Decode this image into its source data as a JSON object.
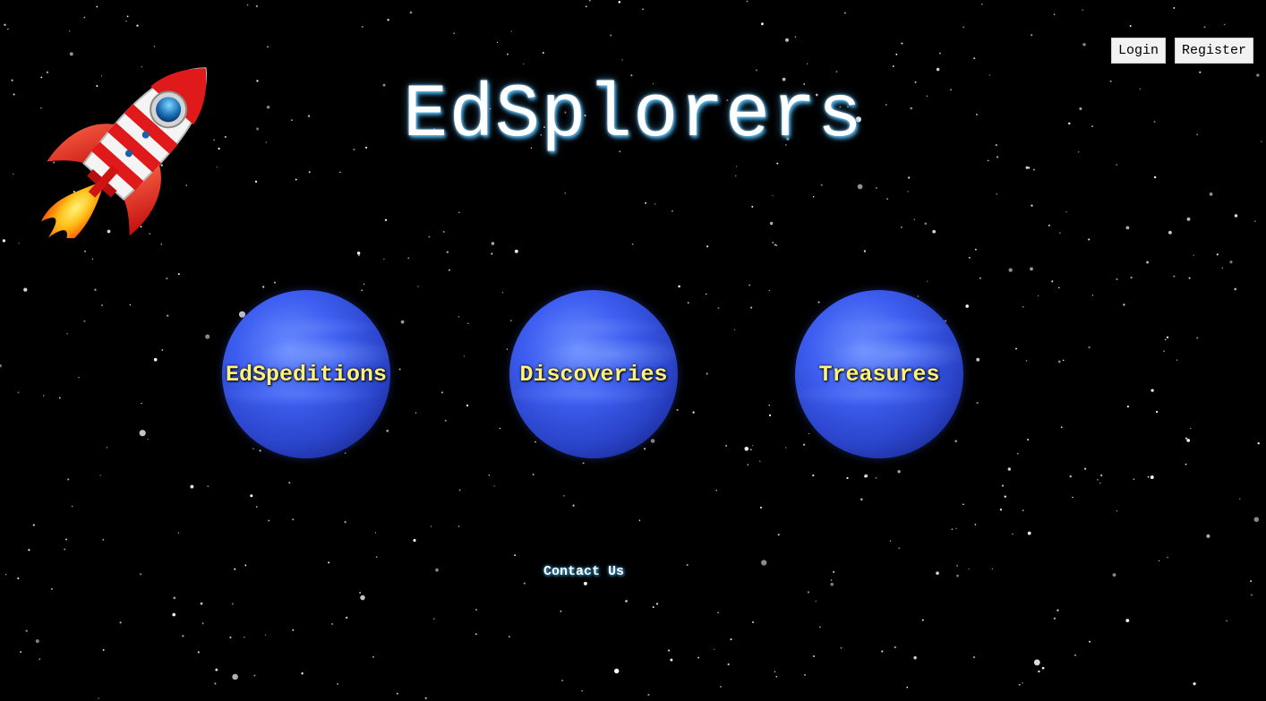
{
  "site": {
    "title": "EdSplorers"
  },
  "auth": {
    "login_label": "Login",
    "register_label": "Register"
  },
  "planets": [
    {
      "label": "EdSpeditions"
    },
    {
      "label": "Discoveries"
    },
    {
      "label": "Treasures"
    }
  ],
  "footer": {
    "contact_label": "Contact Us"
  },
  "icons": {
    "rocket": "rocket-icon",
    "planet": "planet-icon"
  },
  "colors": {
    "background": "#000000",
    "title": "#ffffff",
    "title_glow": "#3fa0d8",
    "planet_label": "#fff27a",
    "planet_blue": "#3d5ef0",
    "button_bg": "#f2f2f2"
  }
}
